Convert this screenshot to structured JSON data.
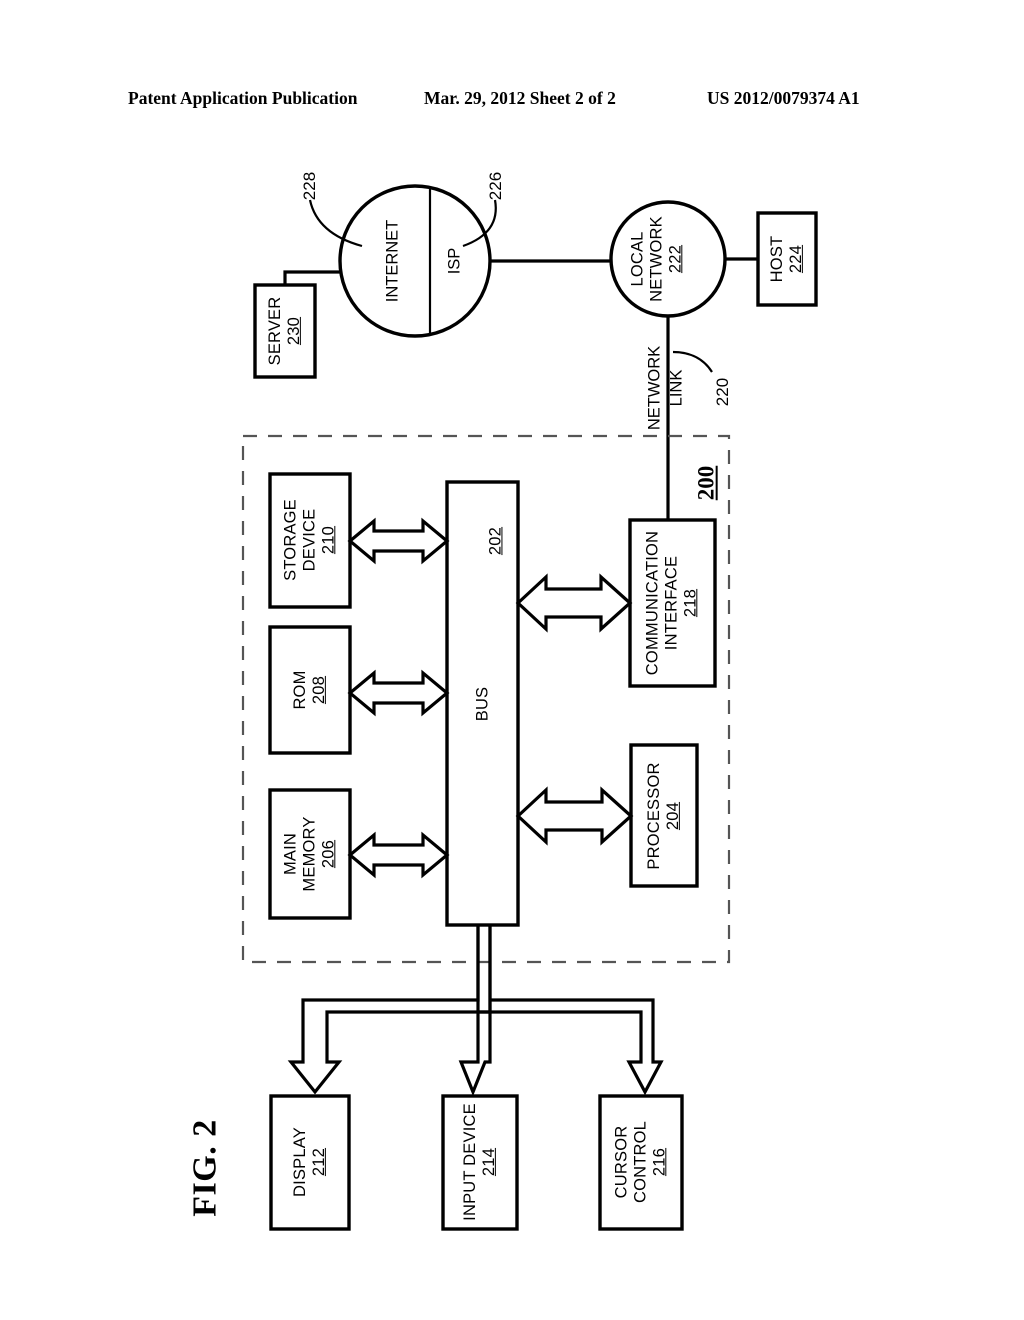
{
  "header": {
    "left": "Patent Application Publication",
    "middle": "Mar. 29, 2012  Sheet 2 of 2",
    "right": "US 2012/0079374 A1"
  },
  "figure": {
    "caption": "FIG. 2",
    "system_number": "200",
    "colors": {
      "line": "#000000",
      "background": "#ffffff",
      "dashed_boundary": "#555555"
    },
    "nodes": {
      "server": {
        "label": "SERVER",
        "number": "230"
      },
      "internet": {
        "label": "INTERNET",
        "number": "228"
      },
      "isp": {
        "label": "ISP",
        "number": "226"
      },
      "local_network": {
        "label_line1": "LOCAL",
        "label_line2": "NETWORK",
        "number": "222"
      },
      "host": {
        "label": "HOST",
        "number": "224"
      },
      "network_link": {
        "label_line1": "NETWORK",
        "label_line2": "LINK",
        "number": "220"
      },
      "storage_device": {
        "label_line1": "STORAGE",
        "label_line2": "DEVICE",
        "number": "210"
      },
      "rom": {
        "label": "ROM",
        "number": "208"
      },
      "main_memory": {
        "label_line1": "MAIN",
        "label_line2": "MEMORY",
        "number": "206"
      },
      "bus": {
        "label": "BUS",
        "number": "202"
      },
      "communication_interface": {
        "label_line1": "COMMUNICATION",
        "label_line2": "INTERFACE",
        "number": "218"
      },
      "processor": {
        "label": "PROCESSOR",
        "number": "204"
      },
      "display": {
        "label": "DISPLAY",
        "number": "212"
      },
      "input_device": {
        "label": "INPUT DEVICE",
        "number": "214"
      },
      "cursor_control": {
        "label_line1": "CURSOR",
        "label_line2": "CONTROL",
        "number": "216"
      }
    }
  }
}
